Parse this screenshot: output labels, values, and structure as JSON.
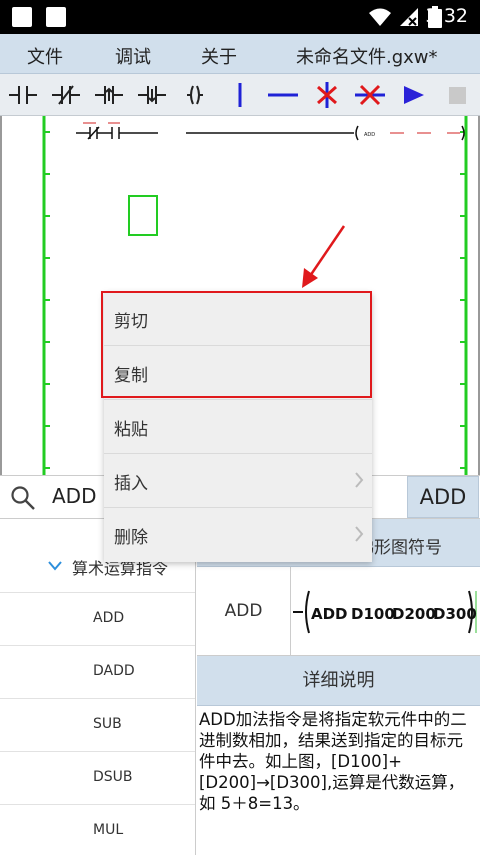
{
  "status_bar": {
    "time": "3:32"
  },
  "menu": {
    "file": "文件",
    "debug": "调试",
    "about": "关于",
    "document_title": "未命名文件.gxw*"
  },
  "toolbar": {
    "buttons": [
      "no-contact-icon",
      "nc-contact-icon",
      "rising-edge-contact-icon",
      "falling-edge-contact-icon",
      "coil-icon",
      "vertical-line-icon",
      "horizontal-line-icon",
      "delete-vertical-line-icon",
      "delete-horizontal-line-icon",
      "run-icon",
      "stop-icon"
    ]
  },
  "ladder": {
    "instruction_label": "ADD"
  },
  "search": {
    "value": "ADD",
    "button_label": "ADD"
  },
  "tree": {
    "category": "算术运算指令",
    "items": [
      "ADD",
      "DADD",
      "SUB",
      "DSUB",
      "MUL"
    ]
  },
  "detail": {
    "symbol_header": "梯形图符号",
    "name": "ADD",
    "symbol": {
      "op": "ADD",
      "a": "D100",
      "b": "D200",
      "c": "D300"
    },
    "detail_header": "详细说明",
    "description": "ADD加法指令是将指定软元件中的二进制数相加，结果送到指定的目标元件中去。如上图，[D100]+[D200]→[D300],运算是代数运算，如 5＋8=13。"
  },
  "context_menu": {
    "items": [
      "剪切",
      "复制",
      "粘贴",
      "插入",
      "删除"
    ]
  },
  "colors": {
    "accent_panel": "#d1dfec",
    "rail_green": "#22cc22",
    "highlight_red": "#e0191c",
    "toolbar_blue": "#1f22d6"
  }
}
